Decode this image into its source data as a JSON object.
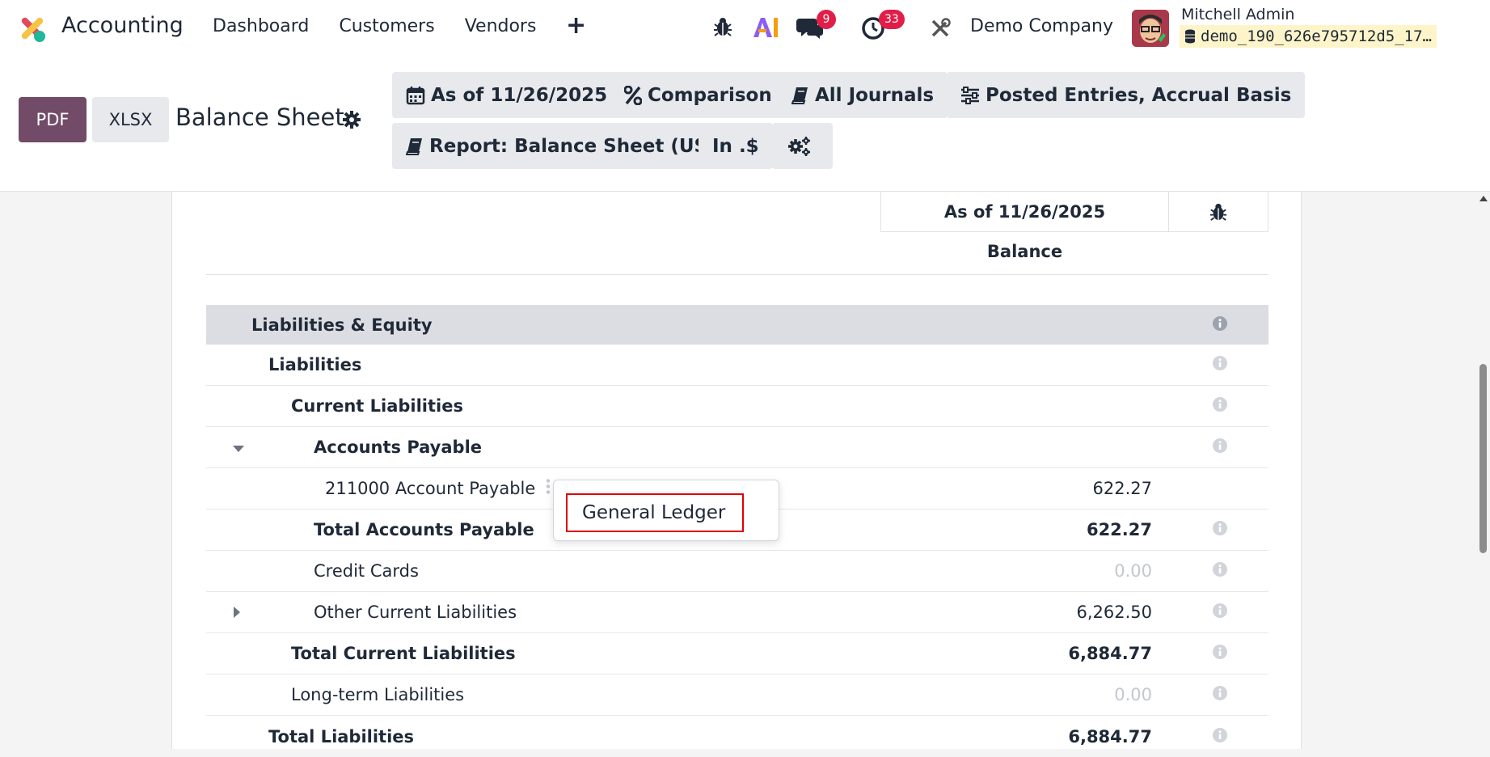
{
  "navbar": {
    "app_name": "Accounting",
    "menu": [
      "Dashboard",
      "Customers",
      "Vendors"
    ],
    "plus_label": "+",
    "messages_badge": "9",
    "activities_badge": "33",
    "company": "Demo Company",
    "user_name": "Mitchell Admin",
    "database": "demo_190_626e795712d5_17…"
  },
  "control_panel": {
    "pdf_label": "PDF",
    "xlsx_label": "XLSX",
    "report_title": "Balance Sheet",
    "filters": {
      "date": "As of 11/26/2025",
      "comparison": "Comparison",
      "journals": "All Journals",
      "options": "Posted Entries, Accrual Basis",
      "report": "Report: Balance Sheet (US)",
      "currency": "In .$"
    }
  },
  "report": {
    "column_header": "As of 11/26/2025",
    "column_subheader": "Balance",
    "rows": [
      {
        "label": "Liabilities & Equity",
        "amount": ""
      },
      {
        "label": "Liabilities",
        "amount": ""
      },
      {
        "label": "Current Liabilities",
        "amount": ""
      },
      {
        "label": "Accounts Payable",
        "amount": ""
      },
      {
        "label": "211000 Account Payable",
        "amount": "622.27"
      },
      {
        "label": "Total Accounts Payable",
        "amount": "622.27"
      },
      {
        "label": "Credit Cards",
        "amount": "0.00"
      },
      {
        "label": "Other Current Liabilities",
        "amount": "6,262.50"
      },
      {
        "label": "Total Current Liabilities",
        "amount": "6,884.77"
      },
      {
        "label": "Long-term Liabilities",
        "amount": "0.00"
      },
      {
        "label": "Total Liabilities",
        "amount": "6,884.77"
      }
    ]
  },
  "context_menu": {
    "item": "General Ledger"
  },
  "colors": {
    "brand": "#714b67",
    "badge": "#e11d48",
    "section_bg": "#dcdde2",
    "highlight": "#e00000"
  }
}
